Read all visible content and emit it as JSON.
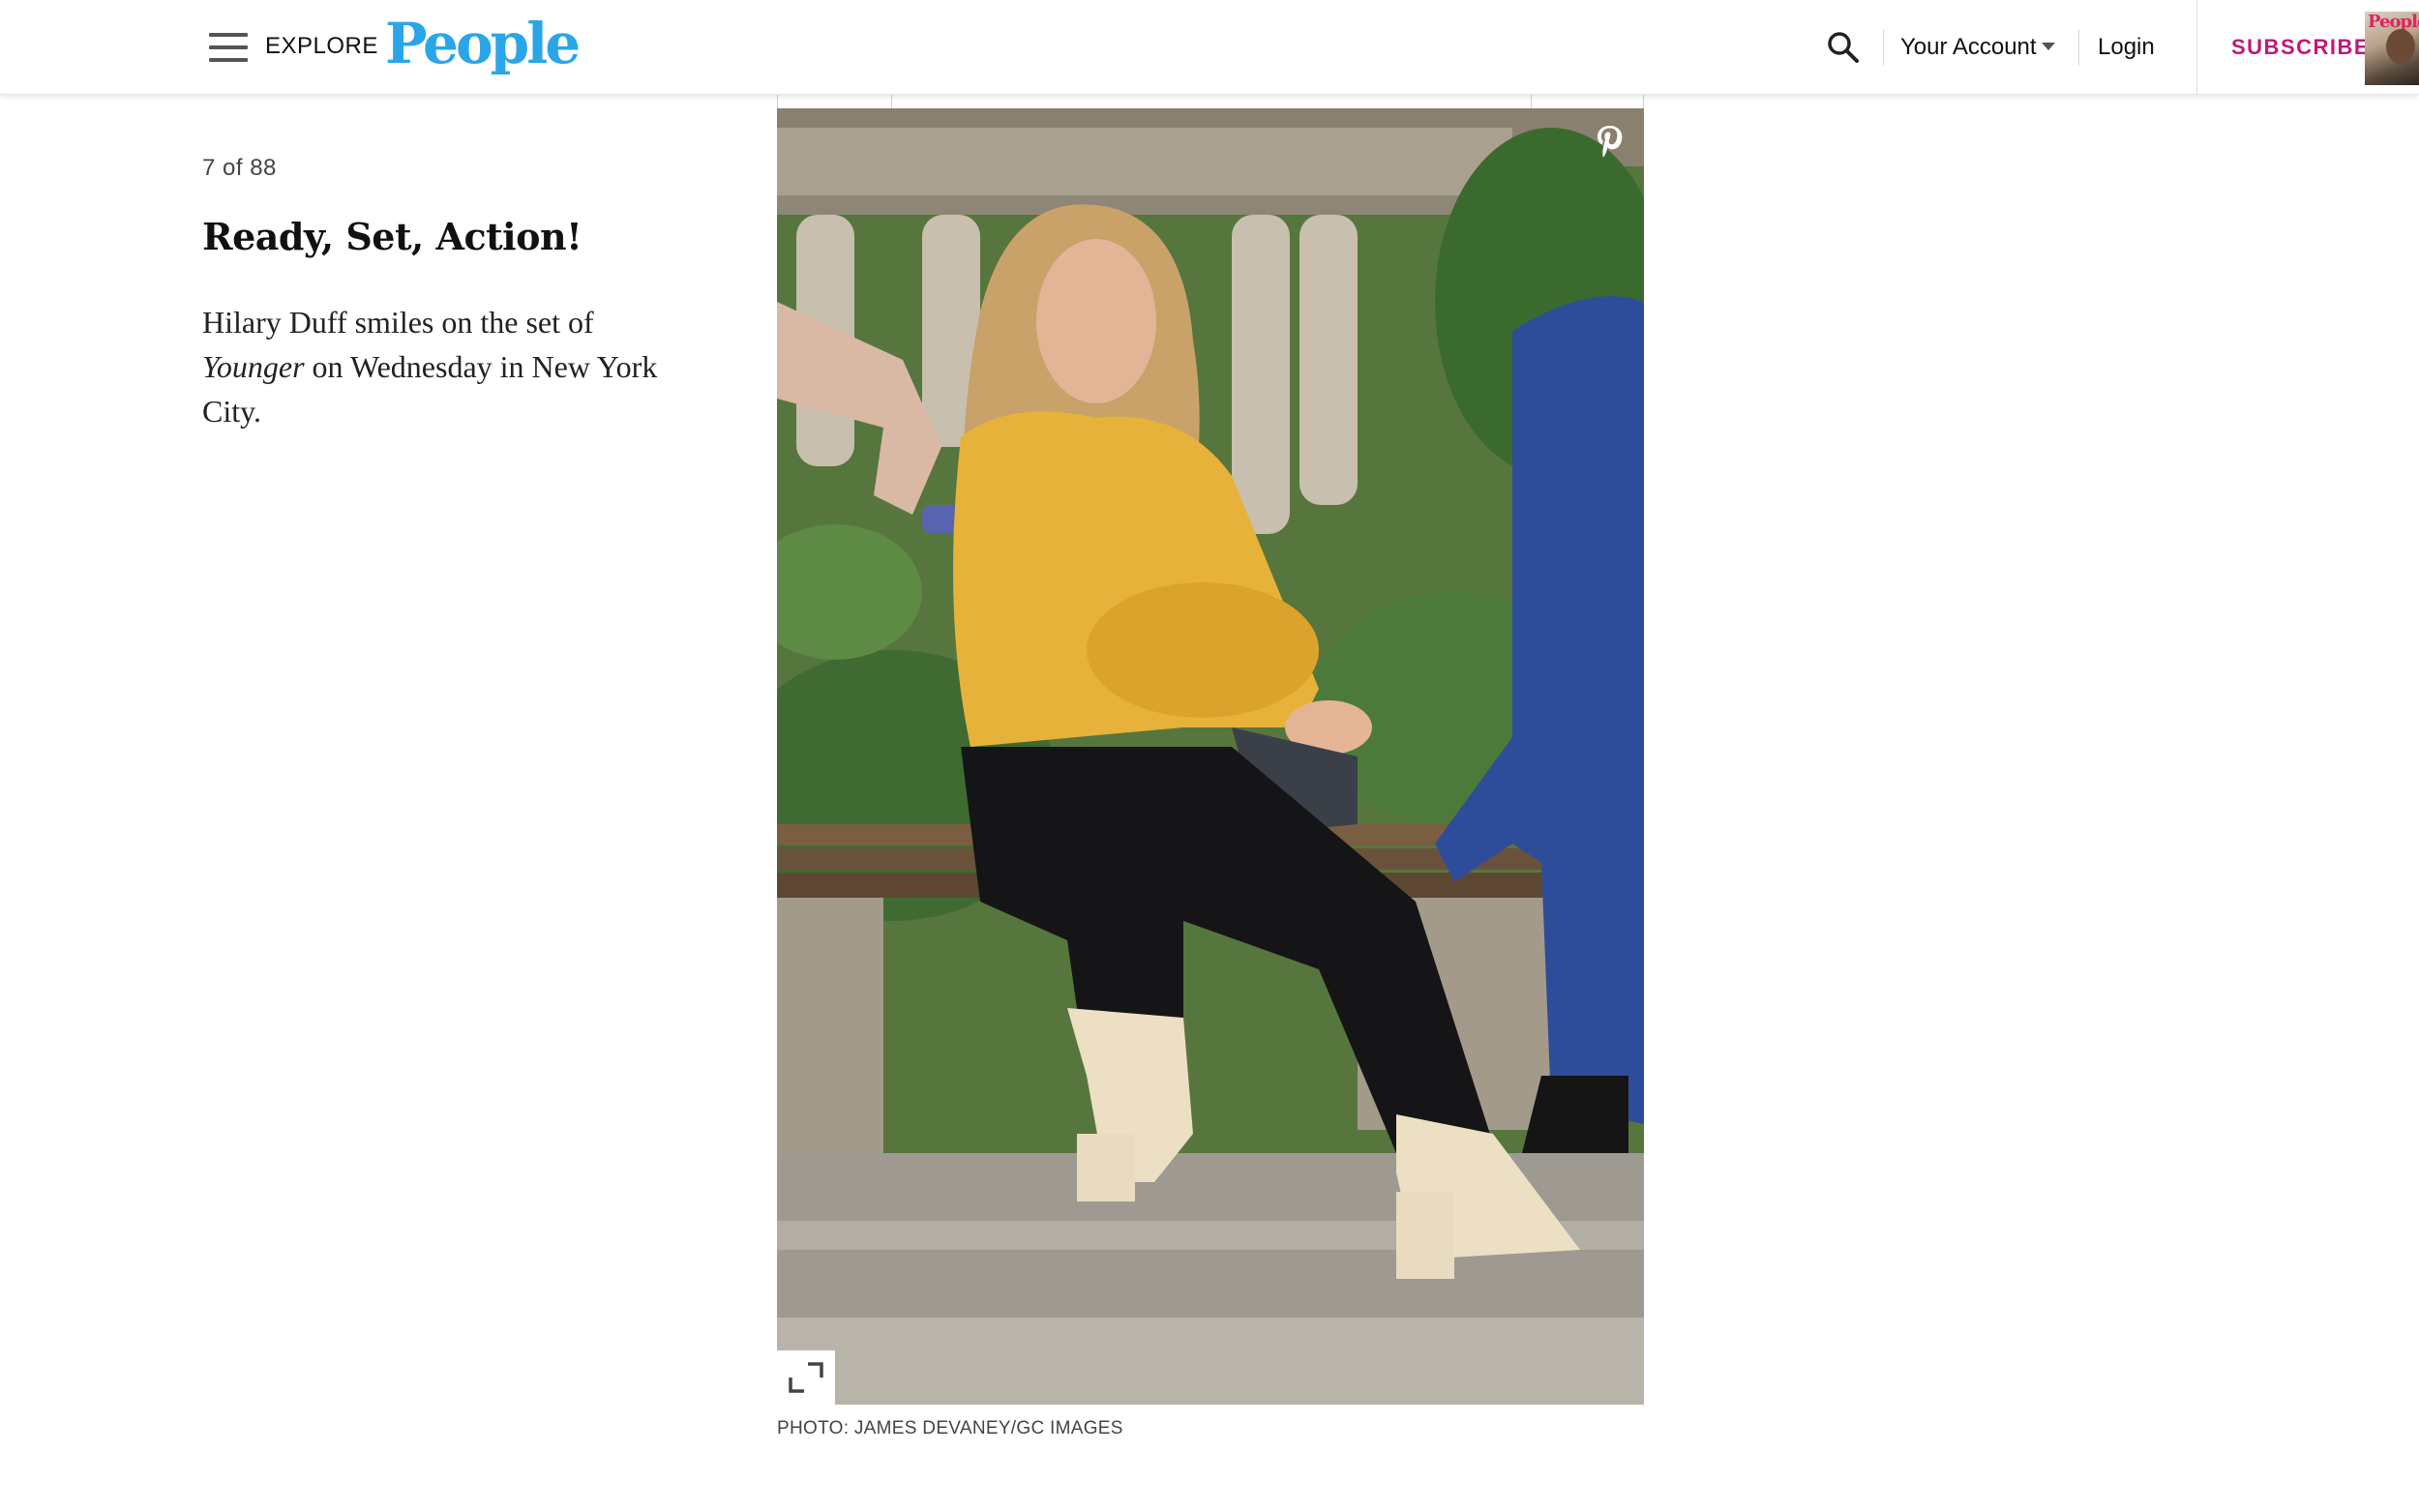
{
  "header": {
    "explore_label": "EXPLORE",
    "logo_text": "People",
    "account_label": "Your Account",
    "login_label": "Login",
    "subscribe_label": "SUBSCRIBE",
    "magazine_cover_text": "People",
    "logo_color": "#2aa6e8",
    "subscribe_color": "#c0187a",
    "icons": {
      "menu": "menu-icon",
      "search": "search-icon",
      "account_dropdown": "caret-down-icon"
    }
  },
  "gallery": {
    "counter": "7 of 88",
    "title": "Ready, Set, Action!",
    "caption": {
      "before": "Hilary Duff smiles on the set of ",
      "italic": "Younger",
      "after": " on Wednesday in New York City."
    },
    "photo_credit": "PHOTO: JAMES DEVANEY/GC IMAGES",
    "icons": {
      "pin": "pinterest-icon",
      "expand": "expand-icon"
    }
  }
}
